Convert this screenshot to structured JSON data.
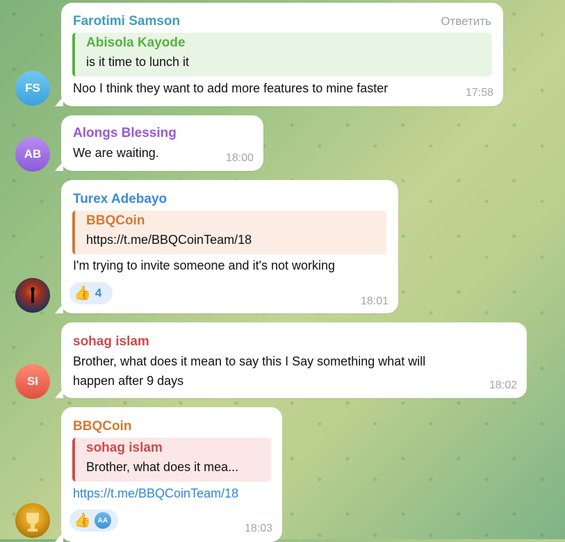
{
  "messages": [
    {
      "avatar_initials": "FS",
      "sender": "Farotimi Samson",
      "action": "Ответить",
      "reply": {
        "name": "Abisola Kayode",
        "text": "is it time to lunch it"
      },
      "text": "Noo I think they want to add more features to mine faster",
      "time": "17:58"
    },
    {
      "avatar_initials": "AB",
      "sender": "Alongs Blessing",
      "text": "We are waiting.",
      "time": "18:00"
    },
    {
      "sender": "Turex Adebayo",
      "reply": {
        "name": "BBQCoin",
        "text": "https://t.me/BBQCoinTeam/18"
      },
      "text": "I'm trying to invite someone and it's not working",
      "reaction": {
        "emoji": "👍",
        "count": "4"
      },
      "time": "18:01"
    },
    {
      "avatar_initials": "SI",
      "sender": "sohag islam",
      "text_line1": "Brother, what does it mean to say this I Say something what will",
      "text_line2": "happen after 9 days",
      "time": "18:02"
    },
    {
      "sender": "BBQCoin",
      "reply": {
        "name": "sohag islam",
        "text": "Brother, what does it mea..."
      },
      "link": "https://t.me/BBQCoinTeam/18",
      "reaction": {
        "emoji": "👍",
        "mini_avatar": "AA"
      },
      "time": "18:03"
    }
  ],
  "colors": {
    "farotimi": "#3e9dbf",
    "abisola": "#56b141",
    "alongs": "#9a57d6",
    "turex": "#3a8bd6",
    "bbqcoin": "#d17a35",
    "sohag": "#cf4b4b"
  }
}
